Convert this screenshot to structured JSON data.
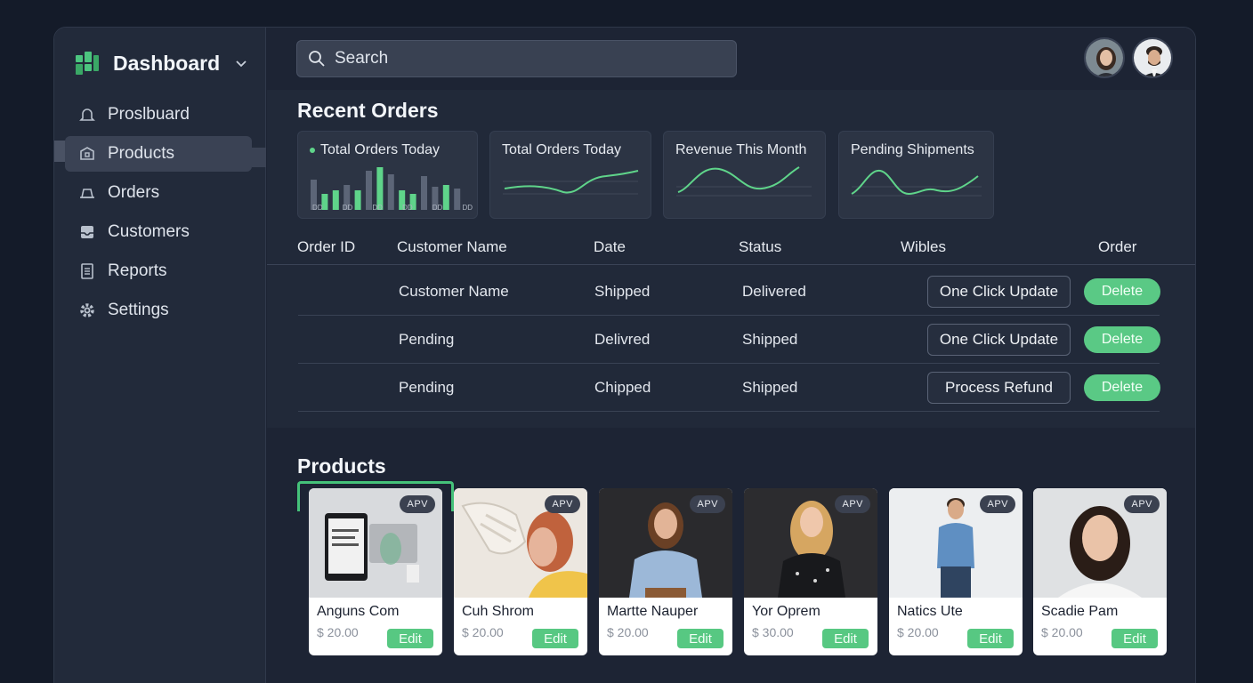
{
  "app": {
    "title": "Dashboard",
    "accent": "#5ac985"
  },
  "sidebar": {
    "items": [
      {
        "label": "Proslbuard",
        "icon": "bell-icon"
      },
      {
        "label": "Products",
        "icon": "box-icon",
        "active": true
      },
      {
        "label": "Orders",
        "icon": "bell-icon"
      },
      {
        "label": "Customers",
        "icon": "inbox-icon"
      },
      {
        "label": "Reports",
        "icon": "document-icon"
      },
      {
        "label": "Settings",
        "icon": "gear-icon"
      }
    ]
  },
  "search": {
    "placeholder": "Search"
  },
  "orders": {
    "title": "Recent Orders",
    "stats": [
      {
        "title": "Total Orders Today",
        "type": "bar"
      },
      {
        "title": "Total Orders Today",
        "type": "line"
      },
      {
        "title": "Revenue This Month",
        "type": "line"
      },
      {
        "title": "Pending Shipments",
        "type": "line"
      }
    ],
    "bar_ticks": [
      "DD",
      "DD",
      "DD",
      "DD",
      "DD",
      "DD"
    ],
    "columns": [
      "Order ID",
      "Customer Name",
      "Date",
      "Status",
      "Wibles",
      "Order"
    ],
    "rows": [
      {
        "order_id": "",
        "customer": "Customer Name",
        "date": "Shipped",
        "status": "Delivered",
        "action": "One Click Update",
        "delete": "Delete"
      },
      {
        "order_id": "",
        "customer": "Pending",
        "date": "Delivred",
        "status": "Shipped",
        "action": "One Click Update",
        "delete": "Delete"
      },
      {
        "order_id": "",
        "customer": "Pending",
        "date": "Chipped",
        "status": "Shipped",
        "action": "Process Refund",
        "delete": "Delete"
      }
    ]
  },
  "products": {
    "title": "Products",
    "items": [
      {
        "name": "Anguns Com",
        "price": "$ 20.00",
        "badge": "APV",
        "edit": "Edit"
      },
      {
        "name": "Cuh Shrom",
        "price": "$ 20.00",
        "badge": "APV",
        "edit": "Edit"
      },
      {
        "name": "Martte Nauper",
        "price": "$ 20.00",
        "badge": "APV",
        "edit": "Edit"
      },
      {
        "name": "Yor Oprem",
        "price": "$ 30.00",
        "badge": "APV",
        "edit": "Edit"
      },
      {
        "name": "Natics Ute",
        "price": "$ 20.00",
        "badge": "APV",
        "edit": "Edit"
      },
      {
        "name": "Scadie Pam",
        "price": "$ 20.00",
        "badge": "APV",
        "edit": "Edit"
      }
    ]
  }
}
